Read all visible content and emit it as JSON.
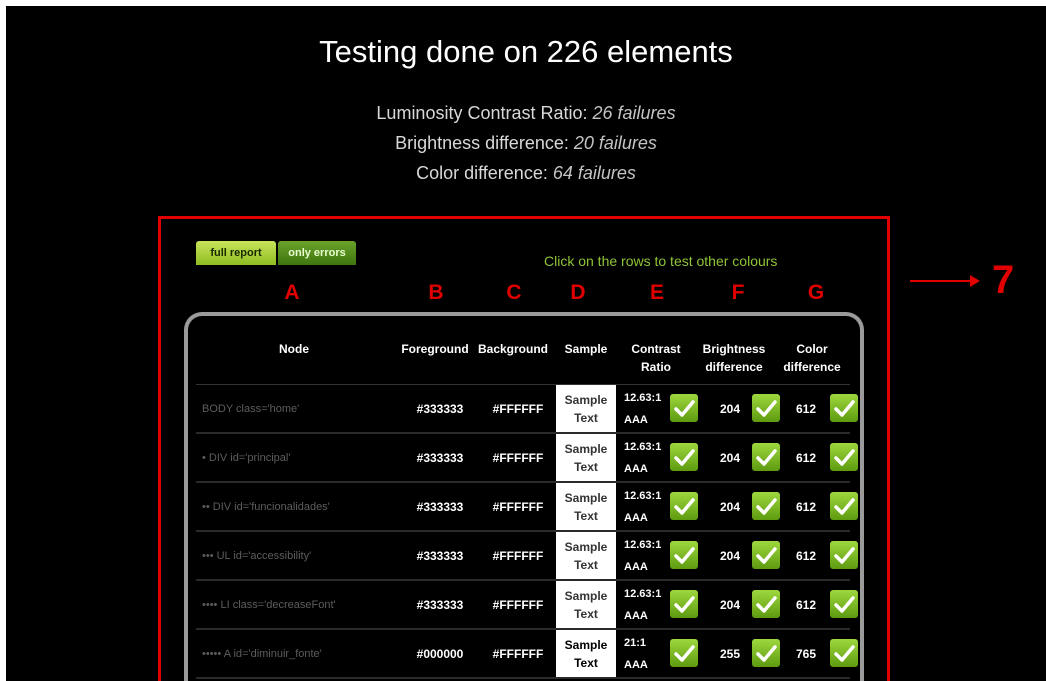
{
  "header": {
    "title": "Testing done on 226 elements"
  },
  "stats": [
    {
      "label": "Luminosity Contrast Ratio: ",
      "value": "26 failures"
    },
    {
      "label": "Brightness difference: ",
      "value": "20 failures"
    },
    {
      "label": "Color difference: ",
      "value": "64 failures"
    }
  ],
  "tabs": {
    "full_report": "full report",
    "only_errors": "only errors"
  },
  "hint": "Click on the rows to test other colours",
  "annotation": {
    "letters": [
      "A",
      "B",
      "C",
      "D",
      "E",
      "F",
      "G"
    ],
    "marker": "7"
  },
  "columns": {
    "node": "Node",
    "foreground": "Foreground",
    "background": "Background",
    "sample": "Sample",
    "contrast_1": "Contrast",
    "contrast_2": "Ratio",
    "brightness_1": "Brightness",
    "brightness_2": "difference",
    "color_1": "Color",
    "color_2": "difference"
  },
  "sample_text": {
    "line1": "Sample",
    "line2": "Text"
  },
  "rows": [
    {
      "node": "BODY  class='home'",
      "fg": "#333333",
      "bg": "#FFFFFF",
      "ratio": "12.63:1",
      "level": "AAA",
      "brightness": "204",
      "color_diff": "612",
      "text_color": "#333333"
    },
    {
      "node": "• DIV  id='principal'",
      "fg": "#333333",
      "bg": "#FFFFFF",
      "ratio": "12.63:1",
      "level": "AAA",
      "brightness": "204",
      "color_diff": "612",
      "text_color": "#333333"
    },
    {
      "node": "•• DIV  id='funcionalidades'",
      "fg": "#333333",
      "bg": "#FFFFFF",
      "ratio": "12.63:1",
      "level": "AAA",
      "brightness": "204",
      "color_diff": "612",
      "text_color": "#333333"
    },
    {
      "node": "••• UL  id='accessibility'",
      "fg": "#333333",
      "bg": "#FFFFFF",
      "ratio": "12.63:1",
      "level": "AAA",
      "brightness": "204",
      "color_diff": "612",
      "text_color": "#333333"
    },
    {
      "node": "•••• LI  class='decreaseFont'",
      "fg": "#333333",
      "bg": "#FFFFFF",
      "ratio": "12.63:1",
      "level": "AAA",
      "brightness": "204",
      "color_diff": "612",
      "text_color": "#333333"
    },
    {
      "node": "••••• A  id='diminuir_fonte'",
      "fg": "#000000",
      "bg": "#FFFFFF",
      "ratio": "21:1",
      "level": "AAA",
      "brightness": "255",
      "color_diff": "765",
      "text_color": "#000000"
    }
  ]
}
